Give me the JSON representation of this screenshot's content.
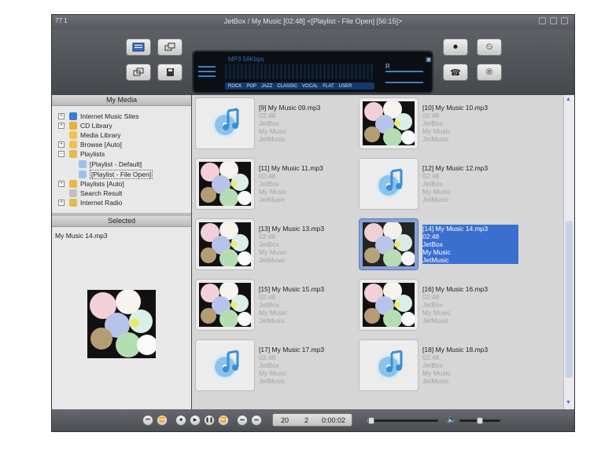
{
  "window": {
    "title": "JetBox / My Music  [02:48]    <[Playlist - File Open]  [56:15]>",
    "left_badge": "77 1"
  },
  "lcd": {
    "format": "MP3 56Kbps",
    "vol_label": "R",
    "eq_tabs": [
      "ROCK",
      "POP",
      "JAZZ",
      "CLASSIC",
      "VOCAL",
      "FLAT",
      "USER"
    ]
  },
  "sidebar": {
    "my_media_header": "My Media",
    "tree": [
      {
        "label": "Internet Music Sites",
        "icon": "globe-icon",
        "expander": "+"
      },
      {
        "label": "CD Library",
        "icon": "cd-icon",
        "expander": "+"
      },
      {
        "label": "Media Library",
        "icon": "folder-icon",
        "expander": ""
      },
      {
        "label": "Browse [Auto]",
        "icon": "folder-icon",
        "expander": "+"
      },
      {
        "label": "Playlists",
        "icon": "playlist-icon",
        "expander": "−"
      },
      {
        "label": "[Playlist - Default]",
        "icon": "file-icon",
        "expander": ""
      },
      {
        "label": "[Playlist - File Open]",
        "icon": "file-icon",
        "expander": ""
      },
      {
        "label": "Playlists [Auto]",
        "icon": "playlist-icon",
        "expander": "+"
      },
      {
        "label": "Search Result",
        "icon": "search-icon",
        "expander": ""
      },
      {
        "label": "Internet Radio",
        "icon": "radio-icon",
        "expander": "+"
      }
    ],
    "selected_header": "Selected",
    "selected_item": "My Music 14.mp3"
  },
  "tracks": [
    {
      "name": "[9] My Music 09.mp3",
      "time": "02:48",
      "artist": "JetBox",
      "album": "My Music",
      "genre": "JetMusic",
      "art": "note",
      "selected": false
    },
    {
      "name": "[10] My Music 10.mp3",
      "time": "02:48",
      "artist": "JetBox",
      "album": "My Music",
      "genre": "JetMusic",
      "art": "bubbles",
      "selected": false
    },
    {
      "name": "[11] My Music 11.mp3",
      "time": "02:48",
      "artist": "JetBox",
      "album": "My Music",
      "genre": "JetMusic",
      "art": "bubbles",
      "selected": false
    },
    {
      "name": "[12] My Music 12.mp3",
      "time": "02:48",
      "artist": "JetBox",
      "album": "My Music",
      "genre": "JetMusic",
      "art": "note",
      "selected": false
    },
    {
      "name": "[13] My Music 13.mp3",
      "time": "02:48",
      "artist": "JetBox",
      "album": "My Music",
      "genre": "JetMusic",
      "art": "bubbles",
      "selected": false
    },
    {
      "name": "[14] My Music 14.mp3",
      "time": "02:48",
      "artist": "JetBox",
      "album": "My Music",
      "genre": "JetMusic",
      "art": "bubbles",
      "selected": true
    },
    {
      "name": "[15] My Music 15.mp3",
      "time": "02:48",
      "artist": "JetBox",
      "album": "My Music",
      "genre": "JetMusic",
      "art": "bubbles",
      "selected": false
    },
    {
      "name": "[16] My Music 16.mp3",
      "time": "02:48",
      "artist": "JetBox",
      "album": "My Music",
      "genre": "JetMusic",
      "art": "bubbles",
      "selected": false
    },
    {
      "name": "[17] My Music 17.mp3",
      "time": "02:48",
      "artist": "JetBox",
      "album": "My Music",
      "genre": "JetMusic",
      "art": "note",
      "selected": false
    },
    {
      "name": "[18] My Music 18.mp3",
      "time": "02:48",
      "artist": "JetBox",
      "album": "My Music",
      "genre": "JetMusic",
      "art": "note",
      "selected": false
    }
  ],
  "player": {
    "track_count": "20",
    "current_index": "2",
    "elapsed": "0:00:02",
    "seek_progress": 0.05,
    "volume_level": 0.5
  },
  "colors": {
    "selection": "#3a6fd0",
    "chrome": "#4a4d52",
    "list_bg": "#d6d6d6"
  }
}
